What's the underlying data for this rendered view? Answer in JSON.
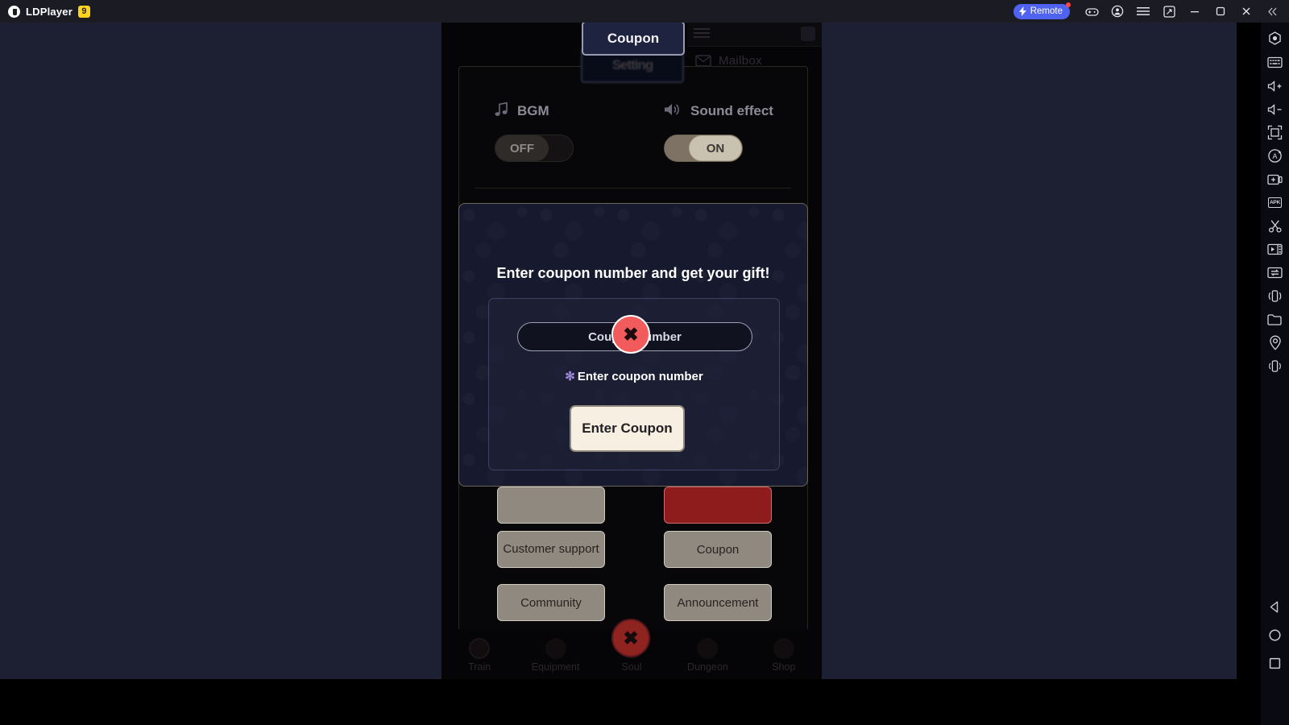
{
  "titlebar": {
    "brand": "LDPlayer",
    "version_badge": "9",
    "remote_label": "Remote",
    "icons": [
      {
        "name": "gamepad-icon"
      },
      {
        "name": "account-icon"
      },
      {
        "name": "menu-icon"
      },
      {
        "name": "multi-instance-icon"
      },
      {
        "name": "minimize-icon"
      },
      {
        "name": "maximize-icon"
      },
      {
        "name": "close-icon"
      },
      {
        "name": "collapse-icon"
      }
    ]
  },
  "sidebar": {
    "items": [
      {
        "name": "operation-settings-icon"
      },
      {
        "name": "keyboard-mapping-icon"
      },
      {
        "name": "volume-up-icon"
      },
      {
        "name": "volume-down-icon"
      },
      {
        "name": "fullscreen-icon"
      },
      {
        "name": "auto-rotate-icon"
      },
      {
        "name": "screenshot-icon"
      },
      {
        "name": "apk-install-icon",
        "label": "APK"
      },
      {
        "name": "scissors-icon"
      },
      {
        "name": "video-record-icon"
      },
      {
        "name": "synchronizer-icon"
      },
      {
        "name": "shake-icon"
      },
      {
        "name": "file-manager-icon"
      },
      {
        "name": "location-icon"
      },
      {
        "name": "virtual-phone-icon"
      },
      {
        "name": "android-back-icon"
      },
      {
        "name": "android-home-icon"
      },
      {
        "name": "android-recents-icon"
      }
    ]
  },
  "game": {
    "background_ui": {
      "mailbox_label": "Mailbox",
      "settings_title": "Setting",
      "audio": [
        {
          "label": "BGM",
          "icon": "music-note-icon",
          "toggle_state": "OFF"
        },
        {
          "label": "Sound effect",
          "icon": "speaker-icon",
          "toggle_state": "ON"
        }
      ],
      "buttons": [
        {
          "label": "Customer support",
          "style": "normal"
        },
        {
          "label": "Coupon",
          "style": "normal"
        },
        {
          "label": "Community",
          "style": "normal"
        },
        {
          "label": "Announcement",
          "style": "normal"
        },
        {
          "label": "",
          "style": "red"
        }
      ],
      "bottom_nav": [
        {
          "label": "Train"
        },
        {
          "label": "Equipment"
        },
        {
          "label": "Soul"
        },
        {
          "label": "Dungeon"
        },
        {
          "label": "Shop"
        }
      ]
    },
    "coupon_dialog": {
      "title": "Coupon",
      "headline": "Enter coupon number and get your gift!",
      "input_placeholder": "Coupon number",
      "hint_asterisk": "✻",
      "hint_text": "Enter coupon number",
      "submit_label": "Enter Coupon",
      "close_glyph": "✖"
    }
  },
  "colors": {
    "accent_blue": "#4f63f0",
    "dialog_bg": "#171a2e",
    "submit_bg": "#f7efe2",
    "close_red": "#f25b5b",
    "badge_yellow": "#ffd21e"
  }
}
